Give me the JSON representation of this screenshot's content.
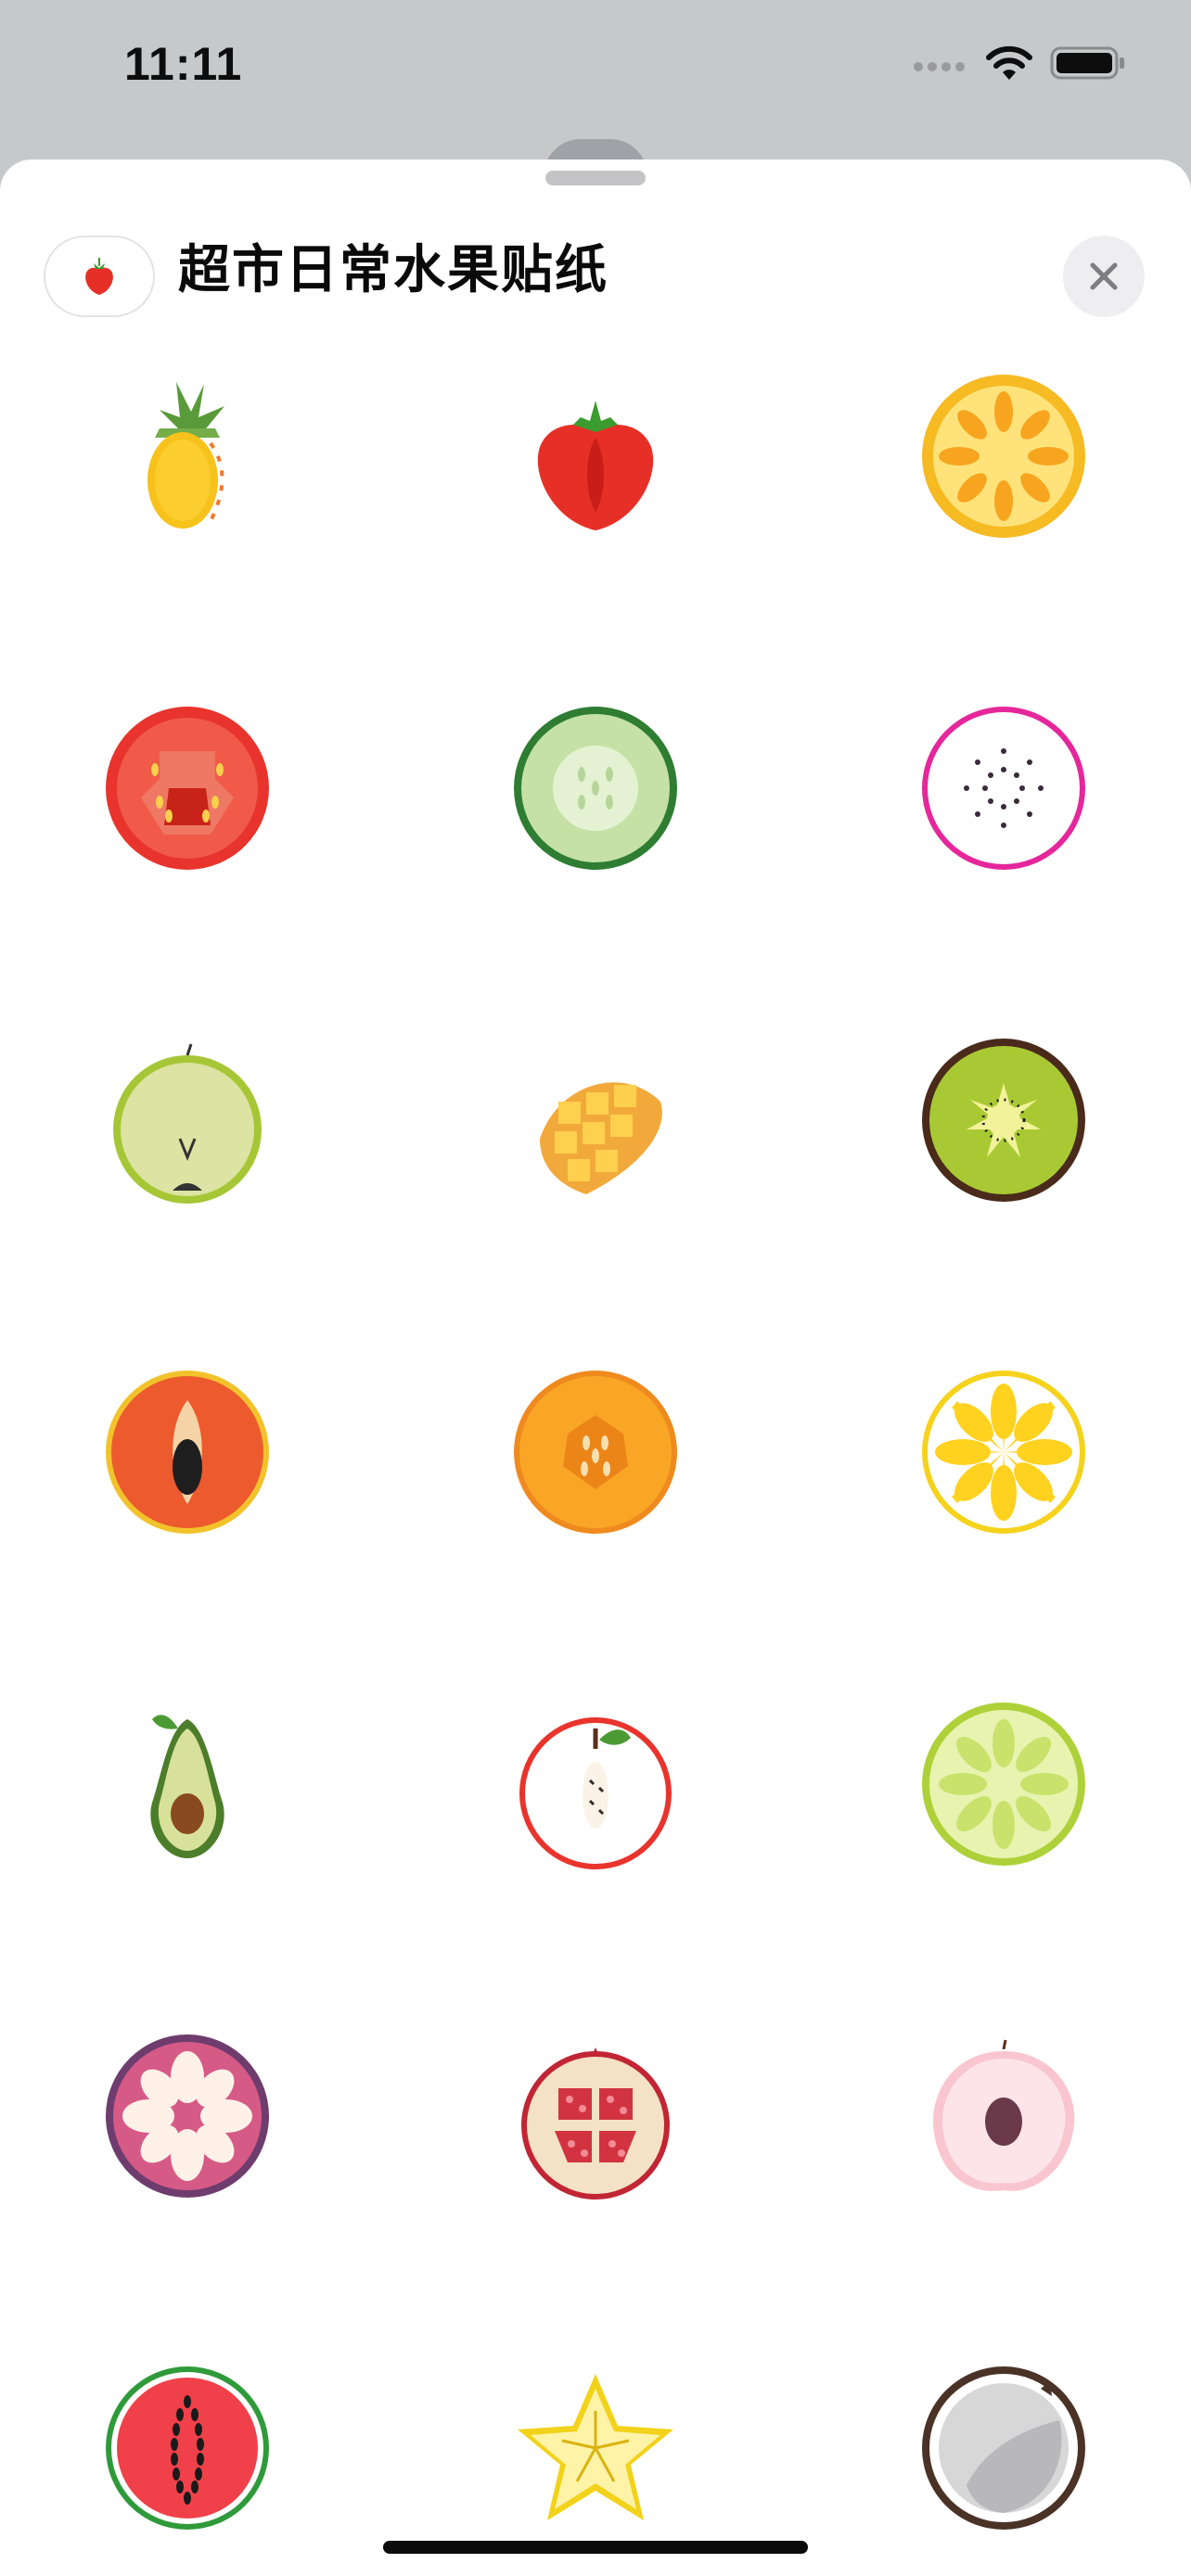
{
  "status_bar": {
    "time": "11:11",
    "icons": [
      "cellular-icon",
      "wifi-icon",
      "battery-icon"
    ]
  },
  "sheet": {
    "title": "超市日常水果贴纸",
    "pack_icon": "strawberry-icon",
    "close_icon": "close-icon"
  },
  "stickers": [
    {
      "name": "pineapple",
      "row": 0,
      "col": 0
    },
    {
      "name": "strawberry",
      "row": 0,
      "col": 1
    },
    {
      "name": "orange-slice",
      "row": 0,
      "col": 2
    },
    {
      "name": "tomato-slice",
      "row": 1,
      "col": 0
    },
    {
      "name": "cucumber-slice",
      "row": 1,
      "col": 1
    },
    {
      "name": "dragon-fruit-slice",
      "row": 1,
      "col": 2
    },
    {
      "name": "pear-half",
      "row": 2,
      "col": 0
    },
    {
      "name": "mango-cubes",
      "row": 2,
      "col": 1
    },
    {
      "name": "kiwi-slice",
      "row": 2,
      "col": 2
    },
    {
      "name": "papaya-slice",
      "row": 3,
      "col": 0
    },
    {
      "name": "cantaloupe-slice",
      "row": 3,
      "col": 1
    },
    {
      "name": "lemon-slice",
      "row": 3,
      "col": 2
    },
    {
      "name": "avocado",
      "row": 4,
      "col": 0
    },
    {
      "name": "apple-half",
      "row": 4,
      "col": 1
    },
    {
      "name": "lime-slice",
      "row": 4,
      "col": 2
    },
    {
      "name": "mangosteen",
      "row": 5,
      "col": 0
    },
    {
      "name": "pomegranate",
      "row": 5,
      "col": 1
    },
    {
      "name": "peach-half",
      "row": 5,
      "col": 2
    },
    {
      "name": "watermelon-slice",
      "row": 6,
      "col": 0
    },
    {
      "name": "starfruit",
      "row": 6,
      "col": 1
    },
    {
      "name": "coconut-half",
      "row": 6,
      "col": 2
    }
  ],
  "colors": {
    "sheet_bg": "#ffffff",
    "backdrop": "#c7c8ca",
    "close_bg": "#eeeef0"
  }
}
